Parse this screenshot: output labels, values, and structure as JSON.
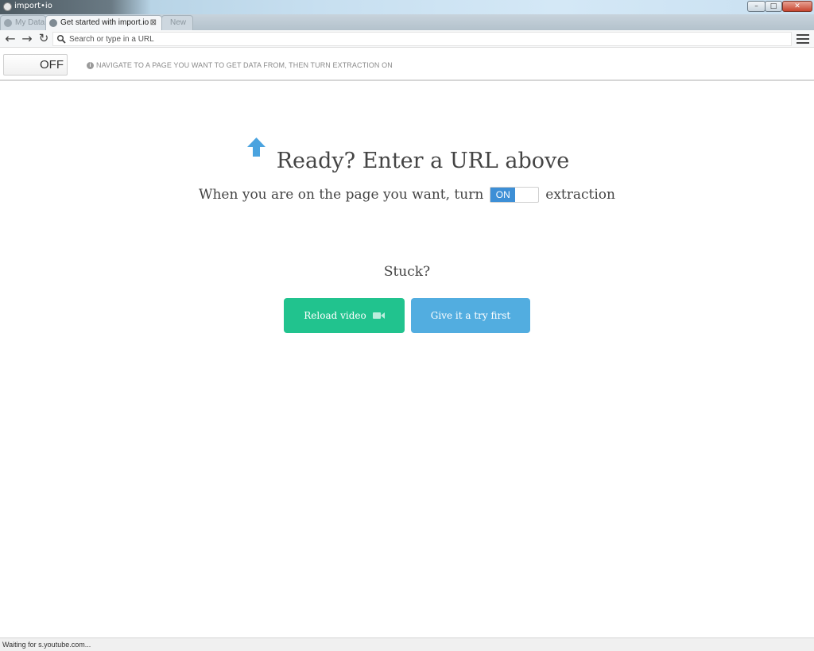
{
  "window": {
    "title": "import•io",
    "minimize_glyph": "–",
    "maximize_glyph": "□",
    "close_glyph": "✕"
  },
  "tabs": [
    {
      "label": "My Data",
      "active": false
    },
    {
      "label": "Get started with import.io",
      "active": true,
      "close_glyph": "⊠"
    },
    {
      "label": "New",
      "active": false
    }
  ],
  "toolbar": {
    "back_glyph": "←",
    "forward_glyph": "→",
    "reload_glyph": "↻",
    "address_placeholder": "Search or type in a URL",
    "address_value": ""
  },
  "extraction_bar": {
    "toggle_label": "OFF",
    "info_glyph": "i",
    "hint": "NAVIGATE TO A PAGE YOU WANT TO GET DATA FROM, THEN TURN EXTRACTION ON"
  },
  "main": {
    "title": "Ready? Enter a URL above",
    "instruction_before": "When you are on the page you want, turn",
    "toggle_on_label": "ON",
    "instruction_after": "extraction",
    "stuck": "Stuck?",
    "reload_button": "Reload video",
    "try_button": "Give it a try first"
  },
  "status": {
    "text": "Waiting for s.youtube.com..."
  },
  "colors": {
    "accent_blue": "#3d8fd6",
    "arrow_blue": "#4aa3df",
    "reload_green": "#21c38e",
    "try_blue": "#52ade0",
    "text_dark": "#444444"
  }
}
